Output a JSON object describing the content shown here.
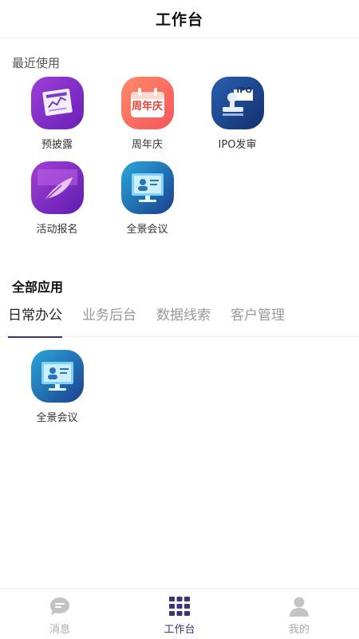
{
  "header": {
    "title": "工作台"
  },
  "recent": {
    "title": "最近使用",
    "apps": [
      {
        "label": "预披露",
        "icon": "document-chart-icon"
      },
      {
        "label": "周年庆",
        "icon": "calendar-anniversary-icon",
        "badge_text": "周年庆"
      },
      {
        "label": "IPO发审",
        "icon": "ipo-stamp-icon",
        "badge_text": "IPO"
      },
      {
        "label": "活动报名",
        "icon": "feather-pen-icon"
      },
      {
        "label": "全景会议",
        "icon": "monitor-meeting-icon"
      }
    ]
  },
  "all_apps": {
    "title": "全部应用",
    "tabs": [
      {
        "label": "日常办公",
        "active": true
      },
      {
        "label": "业务后台",
        "active": false
      },
      {
        "label": "数据线索",
        "active": false
      },
      {
        "label": "客户管理",
        "active": false
      }
    ],
    "apps": [
      {
        "label": "全景会议",
        "icon": "monitor-meeting-icon"
      }
    ]
  },
  "bottom_nav": [
    {
      "label": "消息",
      "icon": "chat-bubble-icon",
      "active": false
    },
    {
      "label": "工作台",
      "icon": "grid-apps-icon",
      "active": true
    },
    {
      "label": "我的",
      "icon": "user-icon",
      "active": false
    }
  ],
  "colors": {
    "accent": "#3b3478",
    "inactive": "#aaaaaa"
  }
}
